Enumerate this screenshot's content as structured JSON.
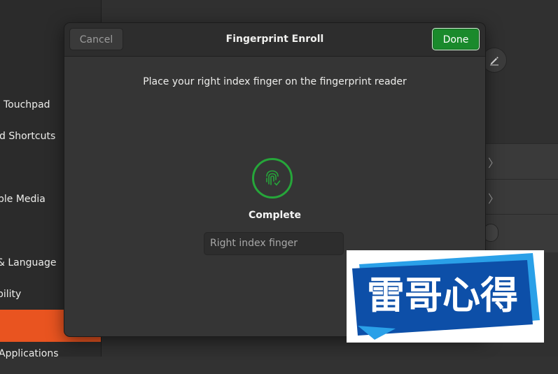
{
  "sidebar": {
    "items": [
      {
        "label": "Touchpad"
      },
      {
        "label": "d Shortcuts"
      },
      {
        "label": "ble Media"
      },
      {
        "label": "& Language"
      },
      {
        "label": "bility"
      },
      {
        "label": ""
      },
      {
        "label": "Applications"
      }
    ]
  },
  "dialog": {
    "title": "Fingerprint Enroll",
    "cancel_label": "Cancel",
    "done_label": "Done",
    "instruction": "Place your right index finger on the fingerprint reader",
    "status": "Complete",
    "finger_name": "Right index finger"
  },
  "watermark": {
    "text": "雷哥心得"
  },
  "colors": {
    "accent": "#e95420",
    "success": "#26a63a",
    "done_button": "#1a8a2c",
    "watermark_blue": "#0d4fa8"
  },
  "icons": {
    "fingerprint": "fingerprint-icon",
    "edit": "edit-icon",
    "chevron": "chevron-right-icon"
  }
}
